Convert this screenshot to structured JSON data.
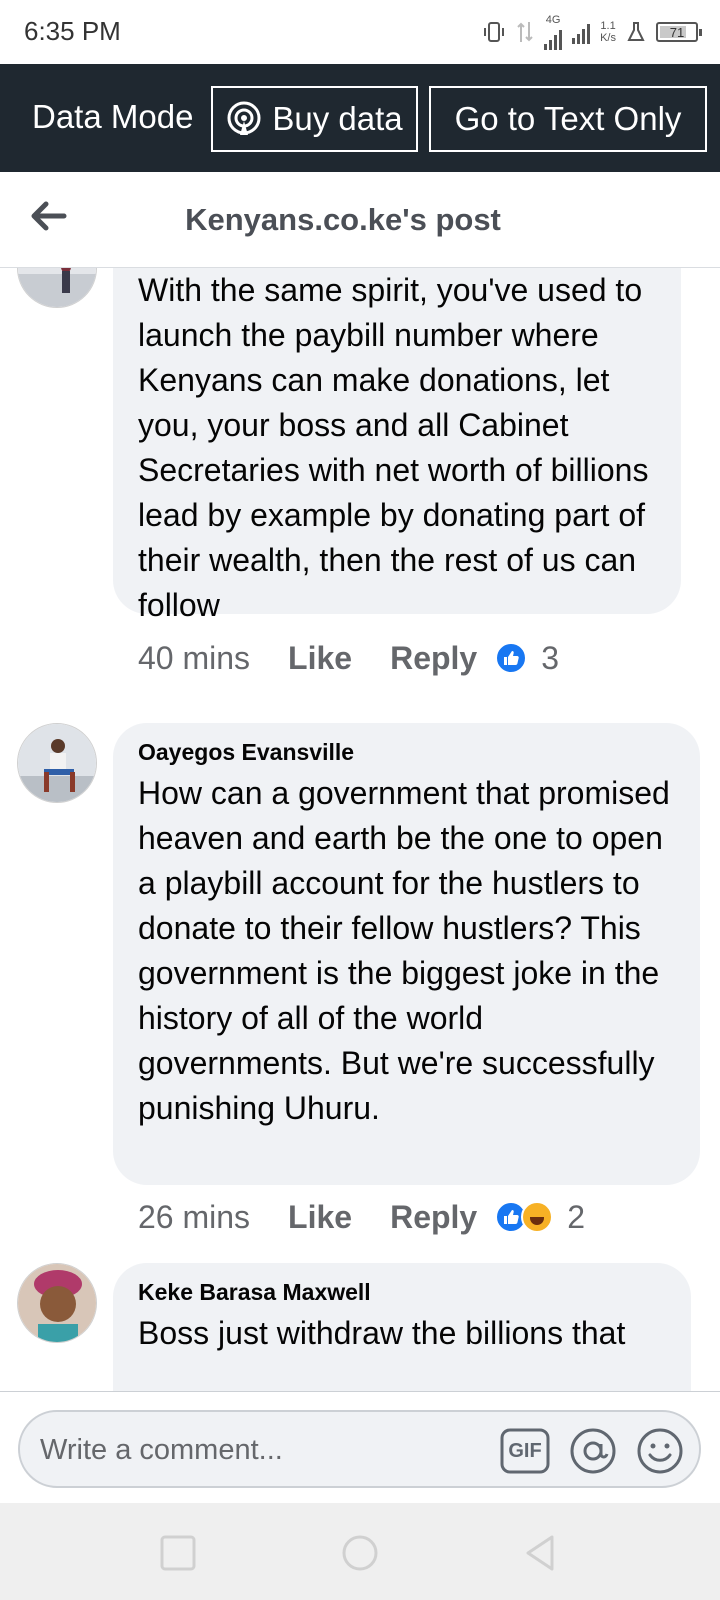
{
  "status_bar": {
    "time": "6:35 PM",
    "network_type": "4G",
    "speed_value": "1.1",
    "speed_unit": "K/s",
    "battery": "71"
  },
  "data_bar": {
    "mode_label": "Data Mode",
    "buy_label": "Buy data",
    "text_only_label": "Go to Text Only"
  },
  "header": {
    "title": "Kenyans.co.ke's post"
  },
  "comments": [
    {
      "author": "",
      "text": "With the same spirit, you've used to launch the paybill number where Kenyans can make donations, let you, your boss and all Cabinet Secretaries with net worth of billions lead by example by donating part of their wealth, then the rest of us can follow",
      "time": "40 mins",
      "like_label": "Like",
      "reply_label": "Reply",
      "reaction_count": "3",
      "reactions": [
        "like-icon"
      ]
    },
    {
      "author": "Oayegos Evansville",
      "text": "How can a government that promised heaven and earth be the one to open a playbill account for the hustlers to donate to their fellow hustlers? This government is the biggest joke in the history of all of the world governments. But we're successfully punishing Uhuru.",
      "time": "26 mins",
      "like_label": "Like",
      "reply_label": "Reply",
      "reaction_count": "2",
      "reactions": [
        "like-icon",
        "haha-icon"
      ]
    },
    {
      "author": "Keke Barasa Maxwell",
      "text": "Boss just withdraw the billions that"
    }
  ],
  "composer": {
    "placeholder": "Write a comment...",
    "gif_label": "GIF"
  },
  "colors": {
    "data_bar_bg": "#1f2830",
    "bubble_bg": "#f0f2f5",
    "like_blue": "#1877f2",
    "meta_gray": "#65676b"
  }
}
